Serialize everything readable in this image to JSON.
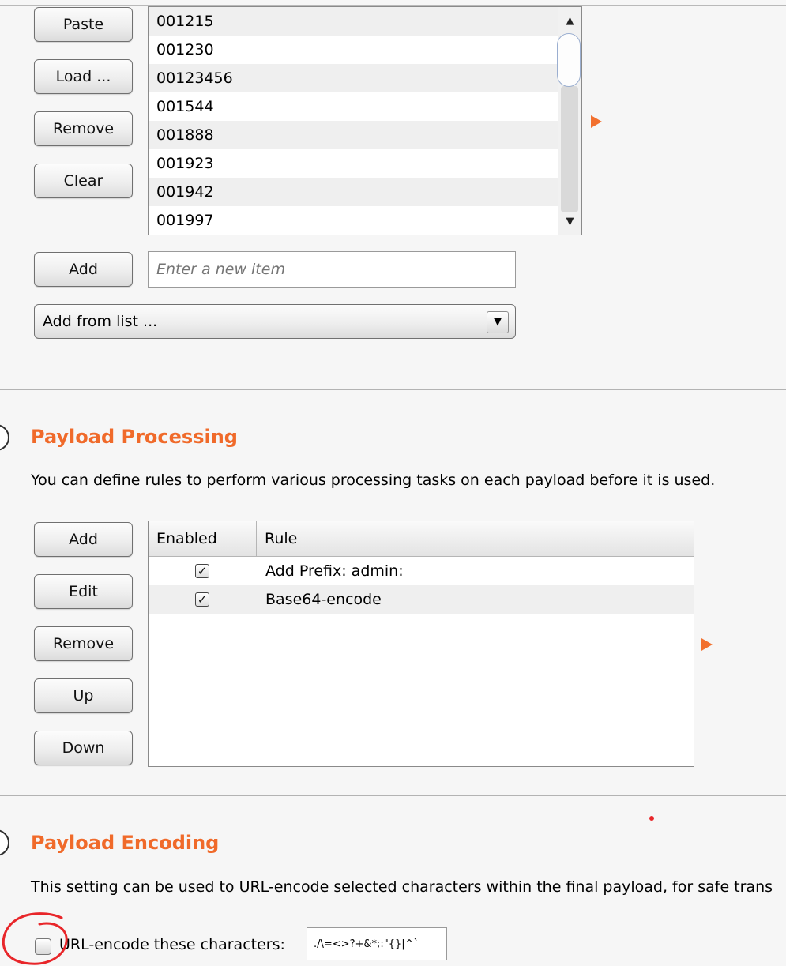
{
  "payload_options": {
    "buttons": {
      "paste": "Paste",
      "load": "Load ...",
      "remove": "Remove",
      "clear": "Clear",
      "add": "Add"
    },
    "items": [
      "001215",
      "001230",
      "00123456",
      "001544",
      "001888",
      "001923",
      "001942",
      "001997"
    ],
    "new_item_placeholder": "Enter a new item",
    "add_from_list": "Add from list ..."
  },
  "payload_processing": {
    "title": "Payload Processing",
    "description": "You can define rules to perform various processing tasks on each payload before it is used.",
    "buttons": {
      "add": "Add",
      "edit": "Edit",
      "remove": "Remove",
      "up": "Up",
      "down": "Down"
    },
    "columns": [
      "Enabled",
      "Rule"
    ],
    "rules": [
      {
        "enabled": true,
        "rule": "Add Prefix: admin:"
      },
      {
        "enabled": true,
        "rule": "Base64-encode"
      }
    ]
  },
  "payload_encoding": {
    "title": "Payload Encoding",
    "description": "This setting can be used to URL-encode selected characters within the final payload, for safe trans",
    "checkbox_label": "URL-encode these characters:",
    "checked": false,
    "characters": "./\\=<>?+&*;:\"{}|^`"
  },
  "help_icon_glyph": "?",
  "colors": {
    "accent": "#f06a2a",
    "annotation": "#e8262a"
  },
  "icons": {
    "scroll_up": "▲",
    "scroll_down": "▼",
    "dropdown": "▼",
    "check": "✓"
  }
}
